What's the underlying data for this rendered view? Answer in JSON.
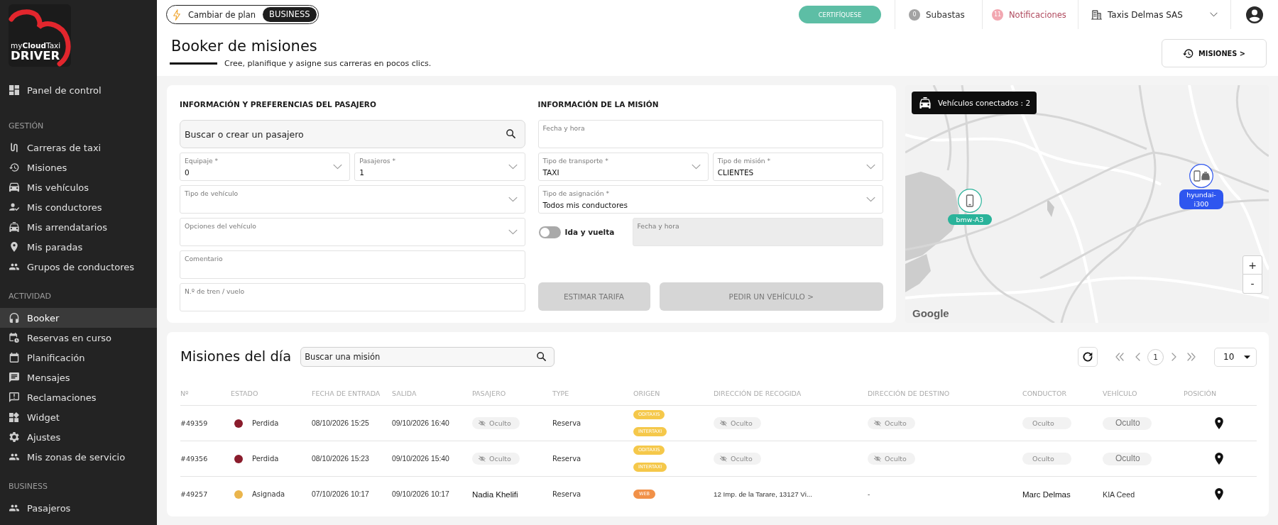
{
  "sidebar": {
    "logo": {
      "brand": "my**Cloud**Taxi",
      "product": "DRIVER"
    },
    "top_items": [
      {
        "label": "Panel de control",
        "selected": false
      }
    ],
    "sections": [
      {
        "title": "GESTIÓN",
        "items": [
          {
            "label": "Carreras de taxi",
            "selected": false
          },
          {
            "label": "Misiones",
            "selected": false
          },
          {
            "label": "Mis vehículos",
            "selected": false
          },
          {
            "label": "Mis conductores",
            "selected": false
          },
          {
            "label": "Mis arrendatarios",
            "selected": false
          },
          {
            "label": "Mis paradas",
            "selected": false
          },
          {
            "label": "Grupos de conductores",
            "selected": false
          }
        ]
      },
      {
        "title": "ACTIVIDAD",
        "items": [
          {
            "label": "Booker",
            "selected": true
          },
          {
            "label": "Reservas en curso",
            "selected": false
          },
          {
            "label": "Planificación",
            "selected": false
          },
          {
            "label": "Mensajes",
            "selected": false
          },
          {
            "label": "Reclamaciones",
            "selected": false
          },
          {
            "label": "Widget",
            "selected": false
          },
          {
            "label": "Ajustes",
            "selected": false
          },
          {
            "label": "Mis zonas de servicio",
            "selected": false
          }
        ]
      },
      {
        "title": "BUSINESS",
        "items": [
          {
            "label": "Pasajeros",
            "selected": false
          }
        ]
      }
    ]
  },
  "top_bar": {
    "plan": {
      "label": "Cambiar de plan",
      "badge": "BUSINESS"
    },
    "certify_button": "CERTIFÍQUESE",
    "auctions": {
      "count": "0",
      "label": "Subastas"
    },
    "notifications": {
      "count": "11",
      "label": "Notificaciones"
    },
    "company": {
      "name": "Taxis Delmas SAS"
    }
  },
  "header": {
    "title": "Booker de misiones",
    "subtitle": "Cree, planifique y asigne sus carreras en pocos clics.",
    "missions_button": "MISIONES >"
  },
  "booking_form": {
    "passenger": {
      "heading": "INFORMACIÓN Y PREFERENCIAS DEL PASAJERO",
      "search": {
        "placeholder": "Buscar o crear un pasajero"
      },
      "rows": [
        [
          {
            "kind": "select",
            "label": "Equipaje *",
            "value": "0"
          },
          {
            "kind": "select",
            "label": "Pasajeros *",
            "value": "1"
          }
        ],
        [
          {
            "kind": "select",
            "label": "Tipo de vehículo"
          }
        ],
        [
          {
            "kind": "select",
            "label": "Opciones del vehículo"
          }
        ],
        [
          {
            "kind": "text",
            "label": "Comentario"
          }
        ],
        [
          {
            "kind": "text",
            "label": "N.º de tren / vuelo"
          }
        ]
      ]
    },
    "mission": {
      "heading": "INFORMACIÓN DE LA MISIÓN",
      "rows": [
        [
          {
            "kind": "text",
            "label": "Fecha y hora"
          }
        ],
        [
          {
            "kind": "select",
            "label": "Tipo de transporte *",
            "value": "TAXI"
          },
          {
            "kind": "select",
            "label": "Tipo de misión *",
            "value": "CLIENTES"
          }
        ],
        [
          {
            "kind": "select",
            "label": "Tipo de asignación *",
            "value": "Todos mis conductores"
          }
        ]
      ],
      "round_trip": {
        "label": "Ida y vuelta",
        "on": false
      },
      "return_date": {
        "label": "Fecha y hora",
        "disabled": true
      },
      "buttons": [
        {
          "label": "ESTIMAR TARIFA",
          "disabled": true
        },
        {
          "label": "PEDIR UN VEHÍCULO >",
          "disabled": true
        }
      ]
    }
  },
  "map": {
    "connected": "Vehículos conectados : 2",
    "vehicles": [
      {
        "label": "bmw-A3",
        "color": "#2ab39a"
      },
      {
        "label": "hyundai-i300",
        "color": "#2e56ef"
      }
    ],
    "zoom_in": "+",
    "zoom_out": "-",
    "attribution": "Google"
  },
  "missions": {
    "title": "Misiones del día",
    "search": {
      "placeholder": "Buscar una misión"
    },
    "pages": [
      {
        "label": "1",
        "selected": true
      }
    ],
    "page_size": "10",
    "columns": [
      "Nº",
      "ESTADO",
      "FECHA DE ENTRADA",
      "SALIDA",
      "PASAJERO",
      "TYPE",
      "ORIGEN",
      "DIRECCIÓN DE RECOGIDA",
      "DIRECCIÓN DE DESTINO",
      "CONDUCTOR",
      "VEHÍCULO",
      "POSICIÓN"
    ],
    "rows": [
      {
        "number": "#49359",
        "status": {
          "label": "Perdida",
          "color": "#8a1c2c"
        },
        "entry": "08/10/2026 15:25",
        "exit": "09/10/2026 16:40",
        "passenger": {
          "text": "Oculto",
          "masked": true
        },
        "type": "Reserva",
        "origins": [
          {
            "label": "ODITAXIS",
            "color": "#f5c84a"
          },
          {
            "label": "INTERTAXI",
            "color": "#f5c84a"
          }
        ],
        "pickup": {
          "text": "Oculto",
          "masked": true
        },
        "destination": {
          "text": "Oculto",
          "masked": true
        },
        "driver": {
          "text": "Oculto",
          "masked": true
        },
        "vehicle": {
          "text": "Oculto",
          "masked": true
        }
      },
      {
        "number": "#49356",
        "status": {
          "label": "Perdida",
          "color": "#8a1c2c"
        },
        "entry": "08/10/2026 15:23",
        "exit": "09/10/2026 15:40",
        "passenger": {
          "text": "Oculto",
          "masked": true
        },
        "type": "Reserva",
        "origins": [
          {
            "label": "ODITAXIS",
            "color": "#f5c84a"
          },
          {
            "label": "INTERTAXI",
            "color": "#f5c84a"
          }
        ],
        "pickup": {
          "text": "Oculto",
          "masked": true
        },
        "destination": {
          "text": "Oculto",
          "masked": true
        },
        "driver": {
          "text": "Oculto",
          "masked": true
        },
        "vehicle": {
          "text": "Oculto",
          "masked": true
        }
      },
      {
        "number": "#49257",
        "status": {
          "label": "Asignada",
          "color": "#eab54c"
        },
        "entry": "07/10/2026 10:17",
        "exit": "09/10/2026 10:17",
        "passenger": {
          "text": "Nadia Khelifi",
          "masked": false
        },
        "type": "Reserva",
        "origins": [
          {
            "label": "WEB",
            "color": "#f19148"
          }
        ],
        "pickup": {
          "text": "12 Imp. de la Tarare, 13127 Vi...",
          "masked": false
        },
        "destination": {
          "text": "-",
          "masked": false
        },
        "driver": {
          "text": "Marc Delmas",
          "masked": false
        },
        "vehicle": {
          "text": "KIA Ceed",
          "masked": false
        }
      }
    ]
  }
}
